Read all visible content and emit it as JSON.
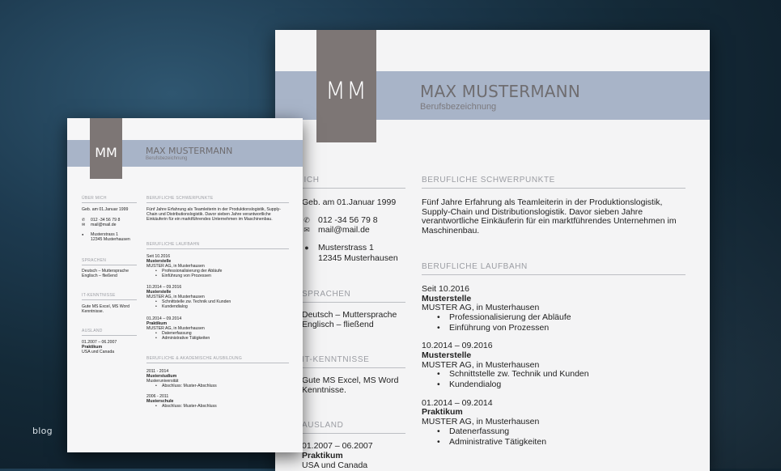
{
  "site": {
    "watermark": "blog"
  },
  "resume": {
    "monogram": "MM",
    "name": "MAX MUSTERMANN",
    "job_title": "Berufsbezeichnung",
    "sections": {
      "about": "ÜBER MICH",
      "focus": "BERUFLICHE SCHWERPUNKTE",
      "career": "BERUFLICHE LAUFBAHN",
      "languages": "SPRACHEN",
      "it": "IT-KENNTNISSE",
      "abroad": "AUSLAND",
      "education": "BERUFLICHE & AKADEMISCHE AUSBILDUNG"
    },
    "contact": {
      "birth": "Geb. am 01.Januar 1999",
      "phone": "012 -34 56 79 8",
      "email": "mail@mail.de",
      "street": "Musterstrass 1",
      "city": "12345 Musterhausen"
    },
    "focus_text": "Fünf Jahre Erfahrung als Teamleiterin in der Produktionslogistik, Supply-Chain und Distributionslogistik. Davor sieben Jahre verantwortliche Einkäuferin für ein marktführendes Unternehmen im Maschinenbau.",
    "focus_lines": [
      "Fünf Jahre Erfahrung als Teamleiterin in der Produktionslogistik,",
      "Supply-Chain und Distributionslogistik. Davor sieben Jahre",
      "verantwortliche Einkäuferin für ein marktführendes Unternehmen im",
      "Maschinenbau."
    ],
    "career": [
      {
        "date": "Seit 10.2016",
        "role": "Musterstelle",
        "company": "MUSTER AG, in Musterhausen",
        "tasks": [
          "Professionalisierung der Abläufe",
          "Einführung von Prozessen"
        ]
      },
      {
        "date": "10.2014 – 09.2016",
        "role": "Musterstelle",
        "company": "MUSTER AG, in Musterhausen",
        "tasks": [
          "Schnittstelle zw. Technik und Kunden",
          "Kundendialog"
        ]
      },
      {
        "date": "01.2014 – 09.2014",
        "role": "Praktikum",
        "company": "MUSTER AG, in Musterhausen",
        "tasks": [
          "Datenerfassung",
          "Administrative Tätigkeiten"
        ]
      }
    ],
    "languages": [
      "Deutsch – Muttersprache",
      "Englisch – fließend"
    ],
    "it_lines": [
      "Gute MS Excel, MS Word",
      "Kenntnisse."
    ],
    "it_small": [
      "Gute MS Excel, MS Word",
      "Kenntnisse."
    ],
    "abroad": {
      "date": "01.2007 – 06.2007",
      "role": "Praktikum",
      "place": "USA und Canada"
    },
    "education": [
      {
        "date": "2011 - 2014",
        "title": "Musterstudium",
        "place": "Musteruniversität",
        "detail": "Abschluss: Muster-Abschluss"
      },
      {
        "date": "2006 - 2011",
        "title": "Musterschule",
        "place": "",
        "detail": "Abschluss: Muster-Abschluss"
      }
    ]
  }
}
